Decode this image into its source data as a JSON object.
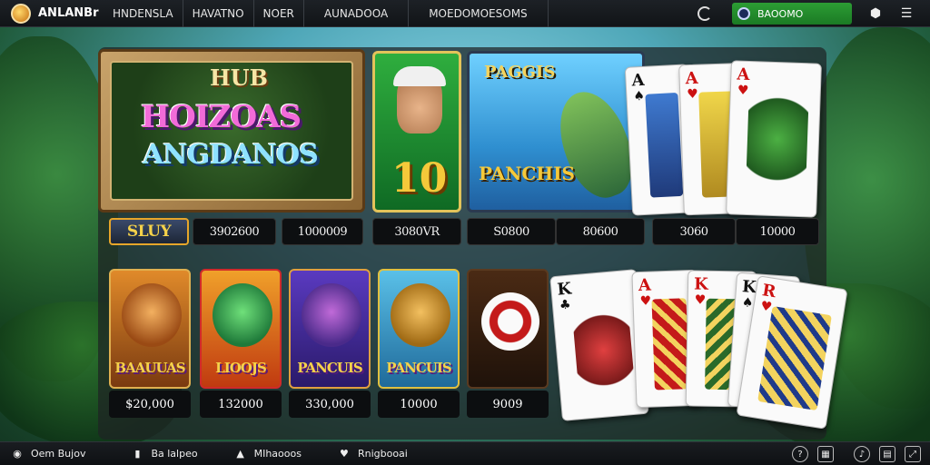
{
  "header": {
    "brand": "ANLANBr",
    "nav": [
      "HNDENSLA",
      "HAVATNO",
      "NOER",
      "AUNADOOA",
      "MOEDOMOESOMS"
    ],
    "balance_label": "BAOOMO",
    "icons": [
      "refresh-icon",
      "notification-icon",
      "menu-icon"
    ]
  },
  "featured": {
    "hero": {
      "top": "HUB",
      "main": "HOIZOAS",
      "sub": "ANGDANOS"
    },
    "ten": {
      "number": "10"
    },
    "fish": {
      "title": "PAGGIS",
      "name": "PANCHIS"
    },
    "labels": {
      "play_btn": "SLUY",
      "row": [
        "3902600",
        "1000009",
        "3080VR",
        "S0800",
        "80600",
        "3060",
        "10000"
      ]
    }
  },
  "games": [
    {
      "name": "BAAUUAS",
      "price": "$20,000",
      "color": "#c8561a"
    },
    {
      "name": "LIOOJS",
      "price": "132000",
      "color": "#e2691a"
    },
    {
      "name": "PANCUIS",
      "price": "330,000",
      "color": "#3a2a8a"
    },
    {
      "name": "PANCUIS",
      "price": "10000",
      "color": "#2f9ad0"
    },
    {
      "name": "",
      "price": "9009",
      "color": "#3a2210"
    }
  ],
  "cards_top": [
    {
      "rank": "A",
      "suit": "♠",
      "red": false
    },
    {
      "rank": "A",
      "suit": "♥",
      "red": true
    },
    {
      "rank": "A",
      "suit": "♥",
      "red": true
    }
  ],
  "cards_bottom": [
    {
      "rank": "K",
      "suit": "♣",
      "red": false
    },
    {
      "rank": "A",
      "suit": "♥",
      "red": true
    },
    {
      "rank": "K",
      "suit": "♥",
      "red": true
    },
    {
      "rank": "K",
      "suit": "♠",
      "red": false
    },
    {
      "rank": "R",
      "suit": "♥",
      "red": true
    }
  ],
  "footer": {
    "nav": [
      "Oem Bujov",
      "Ba lalpeo",
      "MIhaooos",
      "Rnigbooai"
    ]
  }
}
